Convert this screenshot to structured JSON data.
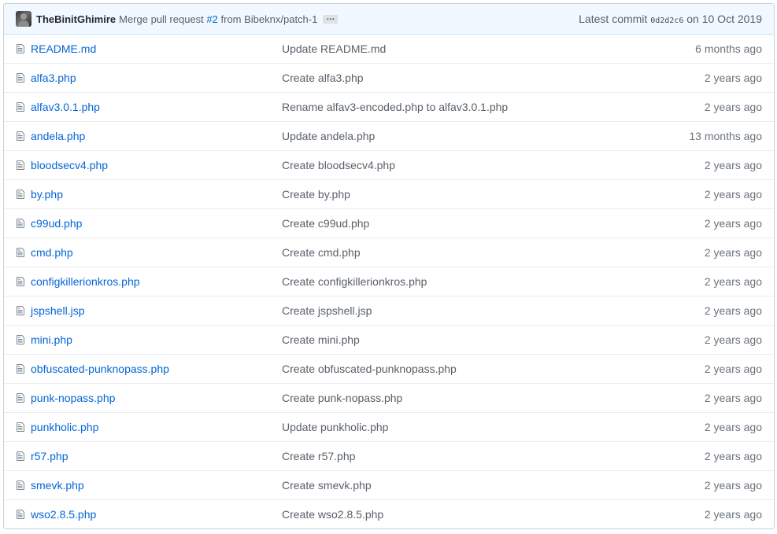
{
  "commit_tease": {
    "author": "TheBinitGhimire",
    "message_prefix": "Merge pull request",
    "pr_number": "#2",
    "message_suffix": "from Bibeknx/patch-1",
    "ellipsis": "…",
    "latest_label": "Latest commit",
    "sha": "0d2d2c6",
    "date_text": "on 10 Oct 2019"
  },
  "files": [
    {
      "name": "README.md",
      "message": "Update README.md",
      "age": "6 months ago",
      "icon": "file-icon"
    },
    {
      "name": "alfa3.php",
      "message": "Create alfa3.php",
      "age": "2 years ago",
      "icon": "file-icon"
    },
    {
      "name": "alfav3.0.1.php",
      "message": "Rename alfav3-encoded.php to alfav3.0.1.php",
      "age": "2 years ago",
      "icon": "file-icon"
    },
    {
      "name": "andela.php",
      "message": "Update andela.php",
      "age": "13 months ago",
      "icon": "file-icon"
    },
    {
      "name": "bloodsecv4.php",
      "message": "Create bloodsecv4.php",
      "age": "2 years ago",
      "icon": "file-icon"
    },
    {
      "name": "by.php",
      "message": "Create by.php",
      "age": "2 years ago",
      "icon": "file-icon"
    },
    {
      "name": "c99ud.php",
      "message": "Create c99ud.php",
      "age": "2 years ago",
      "icon": "file-icon"
    },
    {
      "name": "cmd.php",
      "message": "Create cmd.php",
      "age": "2 years ago",
      "icon": "file-icon"
    },
    {
      "name": "configkillerionkros.php",
      "message": "Create configkillerionkros.php",
      "age": "2 years ago",
      "icon": "file-icon"
    },
    {
      "name": "jspshell.jsp",
      "message": "Create jspshell.jsp",
      "age": "2 years ago",
      "icon": "file-icon"
    },
    {
      "name": "mini.php",
      "message": "Create mini.php",
      "age": "2 years ago",
      "icon": "file-icon"
    },
    {
      "name": "obfuscated-punknopass.php",
      "message": "Create obfuscated-punknopass.php",
      "age": "2 years ago",
      "icon": "file-icon"
    },
    {
      "name": "punk-nopass.php",
      "message": "Create punk-nopass.php",
      "age": "2 years ago",
      "icon": "file-icon"
    },
    {
      "name": "punkholic.php",
      "message": "Update punkholic.php",
      "age": "2 years ago",
      "icon": "file-icon"
    },
    {
      "name": "r57.php",
      "message": "Create r57.php",
      "age": "2 years ago",
      "icon": "file-icon"
    },
    {
      "name": "smevk.php",
      "message": "Create smevk.php",
      "age": "2 years ago",
      "icon": "file-icon"
    },
    {
      "name": "wso2.8.5.php",
      "message": "Create wso2.8.5.php",
      "age": "2 years ago",
      "icon": "file-icon"
    }
  ],
  "colors": {
    "link": "#0366d6",
    "header_bg": "#f1f8ff",
    "muted_text": "#586069",
    "border": "#eaecef"
  }
}
